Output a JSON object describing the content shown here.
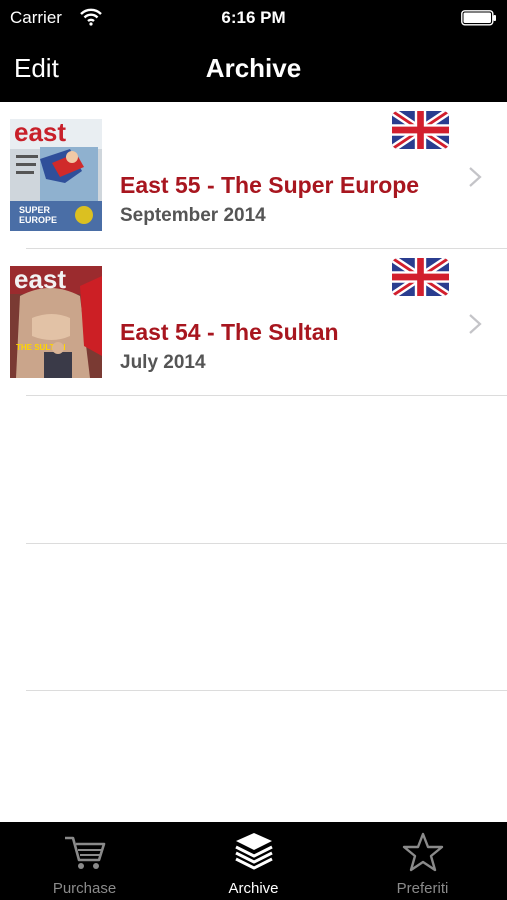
{
  "status_bar": {
    "carrier": "Carrier",
    "time": "6:16 PM"
  },
  "nav": {
    "edit_label": "Edit",
    "title": "Archive"
  },
  "issues": [
    {
      "cover_text": "east",
      "cover_headline": "SUPER EUROPE",
      "flag": "uk-flag-icon",
      "title": "East 55 - The Super Europe",
      "date": "September 2014"
    },
    {
      "cover_text": "east",
      "cover_headline": "THE SULTAN",
      "flag": "uk-flag-icon",
      "title": "East 54 - The Sultan",
      "date": "July 2014"
    }
  ],
  "tabs": [
    {
      "label": "Purchase",
      "icon": "cart-icon",
      "selected": false
    },
    {
      "label": "Archive",
      "icon": "stack-icon",
      "selected": true
    },
    {
      "label": "Preferiti",
      "icon": "star-icon",
      "selected": false
    }
  ],
  "colors": {
    "bar": "#000000",
    "title_red": "#a8161f",
    "date_gray": "#555555",
    "tab_inactive": "#8a8a8a"
  }
}
